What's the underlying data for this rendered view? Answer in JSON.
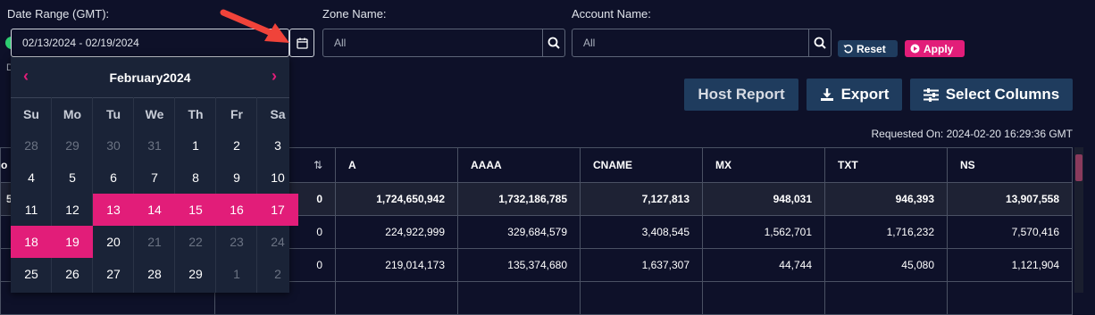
{
  "filters": {
    "date_label": "Date Range (GMT):",
    "date_value": "02/13/2024 - 02/19/2024",
    "zone_label": "Zone Name:",
    "zone_placeholder": "All",
    "account_label": "Account Name:",
    "account_placeholder": "All",
    "reset_label": "Reset",
    "apply_label": "Apply"
  },
  "actions": {
    "host_report": "Host Report",
    "export": "Export",
    "select_columns": "Select Columns"
  },
  "requested_on": "Requested On: 2024-02-20 16:29:36 GMT",
  "calendar": {
    "title": "February2024",
    "weekdays": [
      "Su",
      "Mo",
      "Tu",
      "We",
      "Th",
      "Fr",
      "Sa"
    ],
    "weeks": [
      [
        "28",
        "29",
        "30",
        "31",
        "1",
        "2",
        "3"
      ],
      [
        "4",
        "5",
        "6",
        "7",
        "8",
        "9",
        "10"
      ],
      [
        "11",
        "12",
        "13",
        "14",
        "15",
        "16",
        "17"
      ],
      [
        "18",
        "19",
        "20",
        "21",
        "22",
        "23",
        "24"
      ],
      [
        "25",
        "26",
        "27",
        "28",
        "29",
        "1",
        "2"
      ]
    ]
  },
  "table": {
    "sort_icon": "⇅",
    "columns": [
      "A",
      "AAAA",
      "CNAME",
      "MX",
      "TXT",
      "NS"
    ],
    "total": {
      "lead": "0",
      "values": [
        "1,724,650,942",
        "1,732,186,785",
        "7,127,813",
        "948,031",
        "946,393",
        "13,907,558"
      ]
    },
    "rows": [
      {
        "lead": "0",
        "values": [
          "224,922,999",
          "329,684,579",
          "3,408,545",
          "1,562,701",
          "1,716,232",
          "7,570,416"
        ]
      },
      {
        "lead": "0",
        "values": [
          "219,014,173",
          "135,374,680",
          "1,637,307",
          "44,744",
          "45,080",
          "1,121,904"
        ]
      }
    ],
    "edge_fragments": {
      "header": "o",
      "total": "5"
    }
  },
  "colors": {
    "background": "#0e1129",
    "accent_pink": "#e21d79",
    "button_blue": "#1f3c5e",
    "arrow_red": "#f0433a"
  }
}
